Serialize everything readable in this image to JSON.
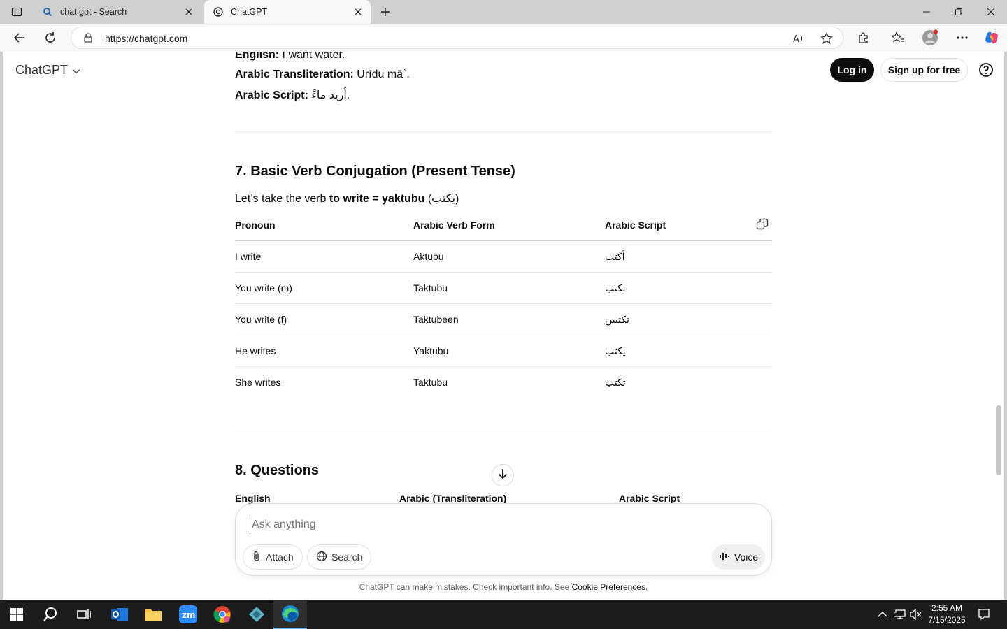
{
  "browser": {
    "tabs": [
      {
        "title": "chat gpt - Search",
        "icon": "search-icon"
      },
      {
        "title": "ChatGPT",
        "icon": "chatgpt-logo-icon"
      }
    ],
    "url": "https://chatgpt.com"
  },
  "header": {
    "brand": "ChatGPT",
    "login": "Log in",
    "signup": "Sign up for free"
  },
  "content": {
    "prev_lines": [
      {
        "label": "English:",
        "value": " I want water."
      },
      {
        "label": "Arabic Transliteration:",
        "value": " Urīdu māʾ."
      },
      {
        "label": "Arabic Script:",
        "value": " أريد ماءً."
      }
    ],
    "section7": {
      "heading": "7. Basic Verb Conjugation (Present Tense)",
      "intro_prefix": "Let’s take the verb ",
      "intro_bold": "to write = yaktubu",
      "intro_suffix": " (يكتب)",
      "table": {
        "headers": [
          "Pronoun",
          "Arabic Verb Form",
          "Arabic Script"
        ],
        "rows": [
          [
            "I write",
            "Aktubu",
            "أكتب"
          ],
          [
            "You write (m)",
            "Taktubu",
            "تكتب"
          ],
          [
            "You write (f)",
            "Taktubeen",
            "تكتبين"
          ],
          [
            "He writes",
            "Yaktubu",
            "يكتب"
          ],
          [
            "She writes",
            "Taktubu",
            "تكتب"
          ]
        ]
      }
    },
    "section8": {
      "heading": "8. Questions",
      "headers": [
        "English",
        "Arabic (Transliteration)",
        "Arabic Script"
      ]
    }
  },
  "composer": {
    "placeholder": "Ask anything",
    "attach": "Attach",
    "search": "Search",
    "voice": "Voice"
  },
  "disclaimer": {
    "text": "ChatGPT can make mistakes. Check important info. See ",
    "link": "Cookie Preferences",
    "end": "."
  },
  "taskbar": {
    "time": "2:55 AM",
    "date": "7/15/2025"
  }
}
